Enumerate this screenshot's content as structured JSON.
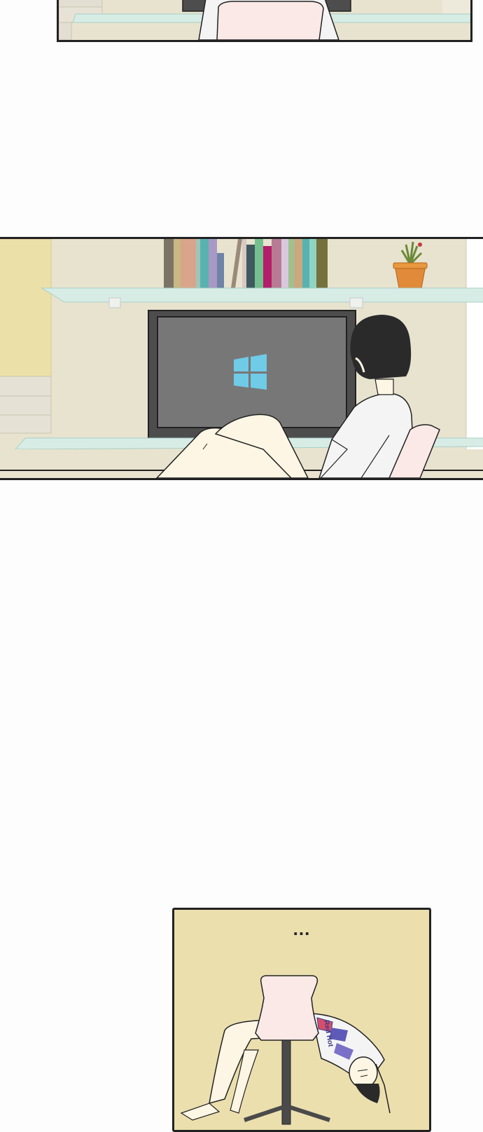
{
  "panels": {
    "bottom": {
      "caption": "..."
    },
    "shirt": {
      "print_text": "Red Hot"
    }
  },
  "colors": {
    "wall": "#e8e3cf",
    "wall_accent": "#ebe0a8",
    "monitor_frame": "#4d4d4d",
    "monitor_screen": "#777777",
    "windows_logo": "#6fcbe6",
    "hair": "#2a2a2a",
    "shirt": "#f4f4f4",
    "skin": "#fdf6e4",
    "chair": "#fbe9e8",
    "plant_pot": "#e08a3a",
    "bottom_panel_bg": "#ebdfae"
  },
  "icons": [
    "windows-logo-icon"
  ]
}
